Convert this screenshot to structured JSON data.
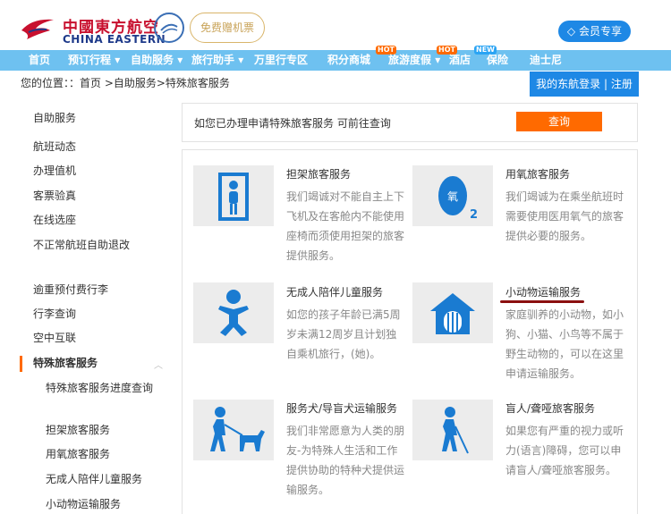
{
  "header": {
    "logo_cn": "中國東方航空",
    "logo_en": "CHINA EASTERN",
    "anniversary": "免费赠机票",
    "member_button": "会员专享"
  },
  "nav": {
    "items": [
      "首页",
      "预订行程",
      "自助服务",
      "旅行助手",
      "万里行专区",
      "积分商城",
      "旅游度假",
      "酒店",
      "保险",
      "迪士尼"
    ],
    "hot": "HOT",
    "new": "NEW"
  },
  "breadcrumb": "您的位置：：首页 >自助服务>特殊旅客服务",
  "login_tab": "我的东航登录 | 注册",
  "sidebar": {
    "items": [
      "自助服务",
      "航班动态",
      "办理值机",
      "客票验真",
      "在线选座",
      "不正常航班自助退改",
      "逾重预付费行李",
      "行李查询",
      "空中互联",
      "特殊旅客服务"
    ],
    "sub_items": [
      "特殊旅客服务进度查询",
      "担架旅客服务",
      "用氧旅客服务",
      "无成人陪伴儿童服务",
      "小动物运输服务"
    ]
  },
  "query": {
    "text": "如您已办理申请特殊旅客服务 可前往查询",
    "button": "查询"
  },
  "services": [
    {
      "title": "担架旅客服务",
      "desc": "我们竭诚对不能自主上下飞机及在客舱内不能使用座椅而须使用担架的旅客提供服务。",
      "icon": "stretcher-icon"
    },
    {
      "title": "用氧旅客服务",
      "desc": "我们竭诚为在乘坐航班时需要使用医用氧气的旅客提供必要的服务。",
      "icon": "oxygen-icon"
    },
    {
      "title": "无成人陪伴儿童服务",
      "desc": "如您的孩子年龄已满5周岁未满12周岁且计划独自乘机旅行，(她)。",
      "icon": "child-icon"
    },
    {
      "title": "小动物运输服务",
      "desc": "家庭驯养的小动物，如小狗、小猫、小鸟等不属于野生动物的，可以在这里申请运输服务。",
      "icon": "pet-icon"
    },
    {
      "title": "服务犬/导盲犬运输服务",
      "desc": "我们非常愿意为人类的朋友-为特殊人生活和工作提供协助的特种犬提供运输服务。",
      "icon": "guide-dog-icon"
    },
    {
      "title": "盲人/聋哑旅客服务",
      "desc": "如果您有严重的视力或听力(语言)障碍，您可以申请盲人/聋哑旅客服务。",
      "icon": "blind-icon"
    }
  ],
  "colors": {
    "nav_bg": "#6ec1f0",
    "accent_orange": "#ff6a00",
    "brand_blue": "#1e88e5",
    "icon_blue": "#1a7bd1"
  }
}
